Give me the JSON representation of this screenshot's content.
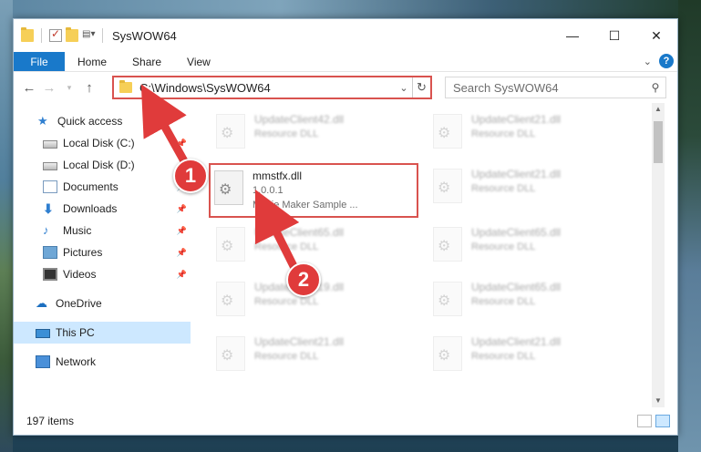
{
  "window": {
    "title": "SysWOW64",
    "buttons": {
      "minimize": "—",
      "maximize": "☐",
      "close": "✕"
    }
  },
  "ribbon": {
    "tabs": [
      "File",
      "Home",
      "Share",
      "View"
    ],
    "help": "?"
  },
  "address": {
    "path": "C:\\Windows\\SysWOW64"
  },
  "search": {
    "placeholder": "Search SysWOW64"
  },
  "sidebar": {
    "items": [
      {
        "label": "Quick access",
        "icon": "star-icon",
        "pinned": false
      },
      {
        "label": "Local Disk (C:)",
        "icon": "disk-icon",
        "pinned": true
      },
      {
        "label": "Local Disk (D:)",
        "icon": "disk-icon",
        "pinned": true
      },
      {
        "label": "Documents",
        "icon": "documents-icon",
        "pinned": true
      },
      {
        "label": "Downloads",
        "icon": "downloads-icon",
        "pinned": true
      },
      {
        "label": "Music",
        "icon": "music-icon",
        "pinned": true
      },
      {
        "label": "Pictures",
        "icon": "pictures-icon",
        "pinned": true
      },
      {
        "label": "Videos",
        "icon": "videos-icon",
        "pinned": true
      },
      {
        "label": "OneDrive",
        "icon": "onedrive-icon",
        "pinned": false
      },
      {
        "label": "This PC",
        "icon": "this-pc-icon",
        "pinned": false,
        "selected": true
      },
      {
        "label": "Network",
        "icon": "network-icon",
        "pinned": false
      }
    ]
  },
  "files": {
    "focused": {
      "name": "mmstfx.dll",
      "version": "1.0.0.1",
      "description": "Movie Maker Sample ..."
    },
    "blurred": [
      {
        "name": "UpdateClient42.dll",
        "type": "Resource DLL"
      },
      {
        "name": "UpdateClient21.dll",
        "type": "Resource DLL"
      },
      {
        "name": "UpdateClient21.dll",
        "type": "Resource DLL"
      },
      {
        "name": "UpdateClient65.dll",
        "type": "Resource DLL"
      },
      {
        "name": "UpdateClient65.dll",
        "type": "Resource DLL"
      },
      {
        "name": "UpdateClient19.dll",
        "type": "Resource DLL"
      },
      {
        "name": "UpdateClient65.dll",
        "type": "Resource DLL"
      },
      {
        "name": "UpdateClient21.dll",
        "type": "Resource DLL"
      },
      {
        "name": "UpdateClient21.dll",
        "type": "Resource DLL"
      }
    ]
  },
  "status": {
    "items": "197 items"
  },
  "annotations": {
    "step1": "1",
    "step2": "2"
  },
  "colors": {
    "accent": "#1979ca",
    "highlight": "#d9534f",
    "selected": "#cde8ff"
  }
}
